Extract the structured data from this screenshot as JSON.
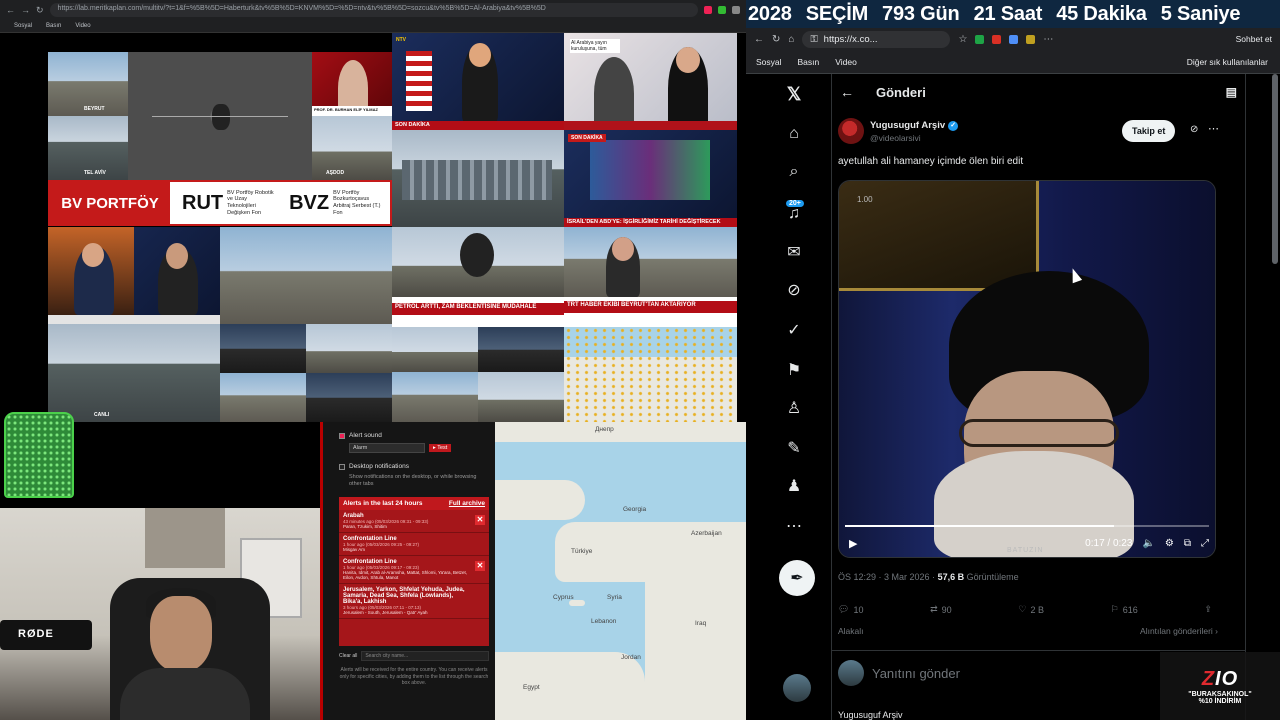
{
  "left_browser": {
    "url": "https://lab.meritkaplan.com/multitv/?t=1&f=%5B%5D=Haberturk&tv%5B%5D=KNVM%5D=%5D=ntv&tv%5B%5D=sozcu&tv%5B%5D=Al-Arabiya&tv%5B%5D",
    "bookmarks": [
      "Sosyal",
      "Basın",
      "Video"
    ]
  },
  "mosaic": {
    "beirut_label": "BEYRUT",
    "telaviv_label": "TEL AVİV",
    "guest_name": "PROF. DR. BURHAN ELİF YILMAZ",
    "ashdod_label": "AŞDOD",
    "channel_top": "NTV",
    "arabic_badge": "Al Arabiya yayın kuruluşuna, tüm",
    "breaking": "SON DAKİKA",
    "israel_headline": "İSRAİL'DEN ABD'YE: İŞGİRLİĞİMİZ TARİHİ DEĞİŞTİRECEK",
    "petrol_headline": "PETROL ARTTI, ZAM BEKLENTİSİNE MÜDAHALE",
    "trt_headline": "TRT HABER EKİBİ BEYRUT'TAN AKTARIYOR",
    "live_label": "CANLI",
    "bv": {
      "brand": "BV PORTFÖY",
      "codes": [
        "RUT",
        "BVZ"
      ],
      "desc1": "BV Portföy Robotik ve Uzay Teknolojileri Değişken Fon",
      "desc2": "BV Portföy Bozkurtoçavus Arbitraj Serbest (T.) Fon"
    },
    "fenerbahce": "FENERBAHÇE"
  },
  "webcam": {
    "mic_brand": "RØDE"
  },
  "alerts": {
    "alert_sound_label": "Alert sound",
    "sound_option": "Alarm",
    "test_label": "▸ Test",
    "desktop_label": "Desktop notifications",
    "desktop_sub": "Show notifications on the desktop, or while browsing other tabs",
    "header": "Alerts in the last 24 hours",
    "archive": "Full archive",
    "items": [
      {
        "title": "Arabah",
        "time": "43 minutes ago (05/03/2026 09:31 - 09:33)",
        "places": "Paran, Tzukim, Shitim"
      },
      {
        "title": "Confrontation Line",
        "time": "1 hour ago (05/03/2026 09:25 - 09:27)",
        "places": "Misgav Am"
      },
      {
        "title": "Confrontation Line",
        "time": "1 hour ago (05/03/2026 09:17 - 09:23)",
        "places": "Hanita, Idmit, Arab al-Aramsha, Mattat, Shlomi, Ya'ara, Betzet, Eilon, Avdon, Shtula, Manot"
      },
      {
        "title": "Jerusalem, Yarkon, Shfelat Yehuda, Judea, Samaria, Dead Sea, Shfela (Lowlands), Bika'a, Lakhish",
        "time": "3 hours ago (05/03/2026 07:11 - 07:13)",
        "places": "Jerusalem - South, Jerusalem - Qatr' Ayah"
      }
    ],
    "clear_label": "Clear all",
    "search_placeholder": "Search city name...",
    "note": "Alerts will be received for the entire country. You can receive alerts only for specific cities, by adding them to the list through the search box above."
  },
  "map": {
    "labels": [
      "Днепр",
      "Georgia",
      "Azerbaijan",
      "Türkiye",
      "Cyprus",
      "Syria",
      "Iraq",
      "Egypt",
      "Lebanon",
      "Jordan"
    ]
  },
  "countdown": {
    "year": "2028",
    "title": "SEÇİM",
    "days": "793 Gün",
    "hours": "21 Saat",
    "minutes": "45 Dakika",
    "seconds": "5 Saniye"
  },
  "right_browser": {
    "url": "https://x.co...",
    "chat_label": "Sohbet et",
    "bookmarks": [
      "Sosyal",
      "Basın",
      "Video"
    ],
    "other_bookmarks": "Diğer sık kullanılanlar"
  },
  "x": {
    "header_title": "Gönderi",
    "notif_badge": "20+",
    "author_name": "Yugusuguf Arşiv",
    "author_handle": "@videolarsivi",
    "follow_label": "Takip et",
    "tweet_text": "ayetullah ali hamaney içimde ölen biri edit",
    "video_top_time": "1.00",
    "video_time": "0:17 / 0:23",
    "video_progress": 0.74,
    "video_watermark": "BATUZIN",
    "meta_time": "ÖS 12:29 · 3 Mar 2026 · ",
    "views": "57,6 B",
    "views_label": "Görüntüleme",
    "replies": "10",
    "reposts": "90",
    "likes": "2 B",
    "bookmarks": "616",
    "relevant_label": "Alakalı",
    "quotes_label": "Alıntılan gönderileri ›",
    "reply_placeholder": "Yanıtını gönder",
    "next_author": "Yugusuguf Arşiv"
  },
  "promo": {
    "logo_a": "Z",
    "logo_b": "IO",
    "code": "\"BURAKSAKINOL\"",
    "discount": "%10 İNDİRİM"
  }
}
